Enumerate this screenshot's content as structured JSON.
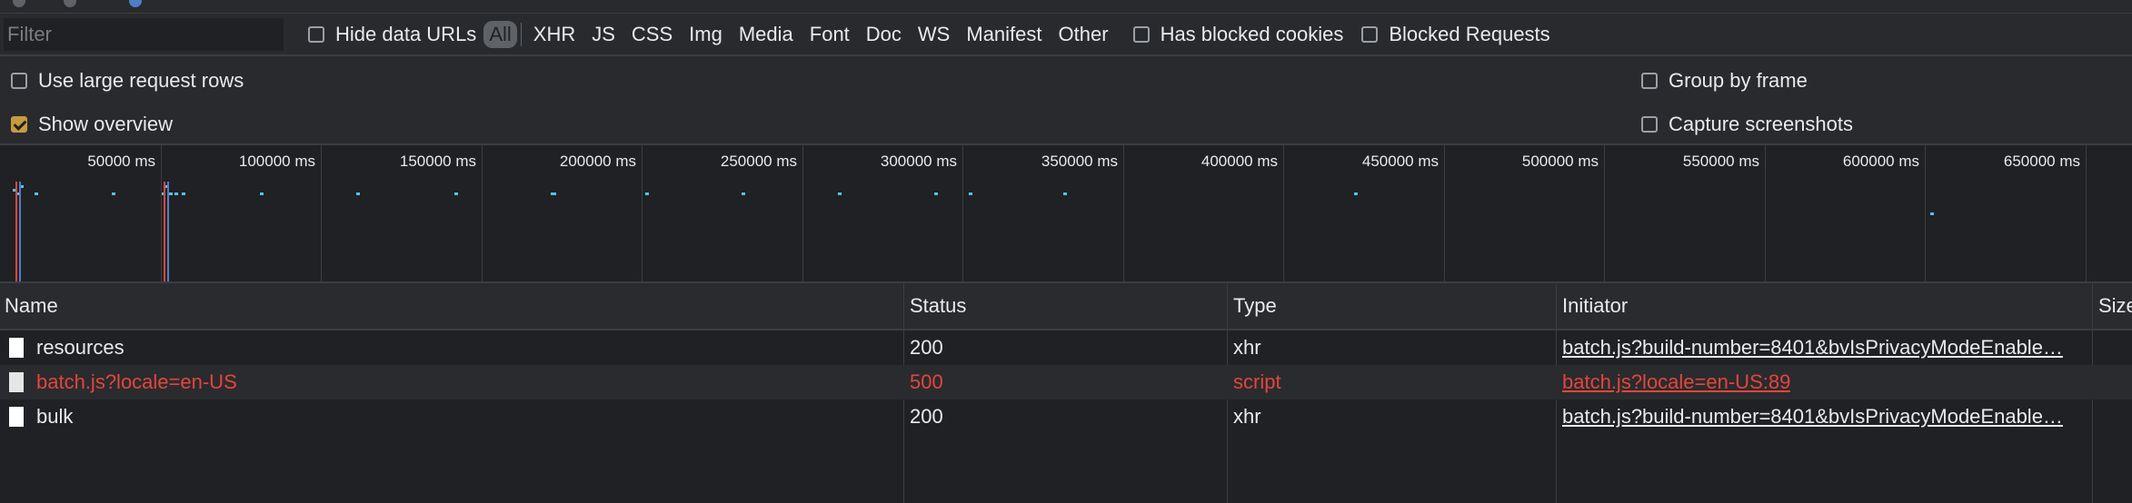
{
  "filter": {
    "placeholder": "Filter"
  },
  "toolbar": {
    "hide_data_urls": "Hide data URLs",
    "types": [
      "All",
      "XHR",
      "JS",
      "CSS",
      "Img",
      "Media",
      "Font",
      "Doc",
      "WS",
      "Manifest",
      "Other"
    ],
    "active_type": "All",
    "has_blocked_cookies": "Has blocked cookies",
    "blocked_requests": "Blocked Requests"
  },
  "settings": {
    "use_large_rows": {
      "label": "Use large request rows",
      "checked": false
    },
    "show_overview": {
      "label": "Show overview",
      "checked": true
    },
    "group_by_frame": {
      "label": "Group by frame",
      "checked": false
    },
    "capture_screenshots": {
      "label": "Capture screenshots",
      "checked": false
    }
  },
  "overview": {
    "ticks": [
      "50000 ms",
      "100000 ms",
      "150000 ms",
      "200000 ms",
      "250000 ms",
      "300000 ms",
      "350000 ms",
      "400000 ms",
      "450000 ms",
      "500000 ms",
      "550000 ms",
      "600000 ms",
      "650000 ms"
    ]
  },
  "columns": {
    "name": "Name",
    "status": "Status",
    "type": "Type",
    "initiator": "Initiator",
    "size": "Size"
  },
  "rows": [
    {
      "name": "resources",
      "status": "200",
      "type": "xhr",
      "initiator": "batch.js?build-number=8401&bvIsPrivacyModeEnable…",
      "error": false
    },
    {
      "name": "batch.js?locale=en-US",
      "status": "500",
      "type": "script",
      "initiator": "batch.js?locale=en-US:89",
      "error": true
    },
    {
      "name": "bulk",
      "status": "200",
      "type": "xhr",
      "initiator": "batch.js?build-number=8401&bvIsPrivacyModeEnable…",
      "error": false
    }
  ],
  "colors": {
    "error": "#e4453d",
    "accent": "#c79a3f",
    "marker": "#4fc3f7"
  }
}
